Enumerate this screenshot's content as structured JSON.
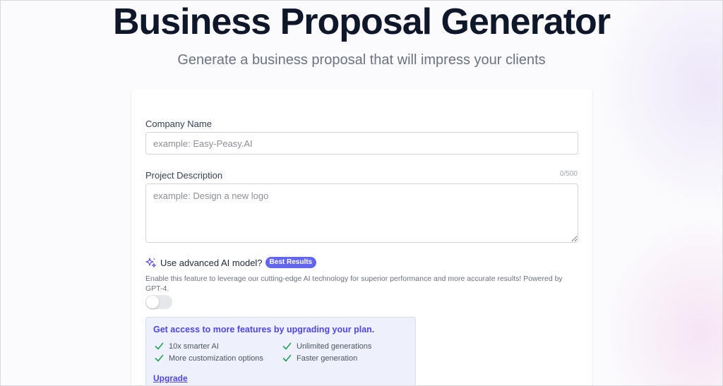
{
  "header": {
    "title": "Business Proposal Generator",
    "subtitle": "Generate a business proposal that will impress your clients"
  },
  "form": {
    "company_name": {
      "label": "Company Name",
      "placeholder": "example: Easy-Peasy.AI",
      "value": ""
    },
    "project_description": {
      "label": "Project Description",
      "placeholder": "example: Design a new logo",
      "value": "",
      "counter": "0/500"
    },
    "advanced_ai": {
      "label": "Use advanced AI model?",
      "badge": "Best Results",
      "description": "Enable this feature to leverage our cutting-edge AI technology for superior performance and more accurate results! Powered by GPT-4.",
      "enabled": false
    }
  },
  "upgrade": {
    "title": "Get access to more features by upgrading your plan.",
    "features": [
      "10x smarter AI",
      "Unlimited generations",
      "More customization options",
      "Faster generation"
    ],
    "link_label": "Upgrade"
  },
  "colors": {
    "accent": "#6366f1",
    "check": "#22a05a",
    "title": "#0f172a"
  }
}
